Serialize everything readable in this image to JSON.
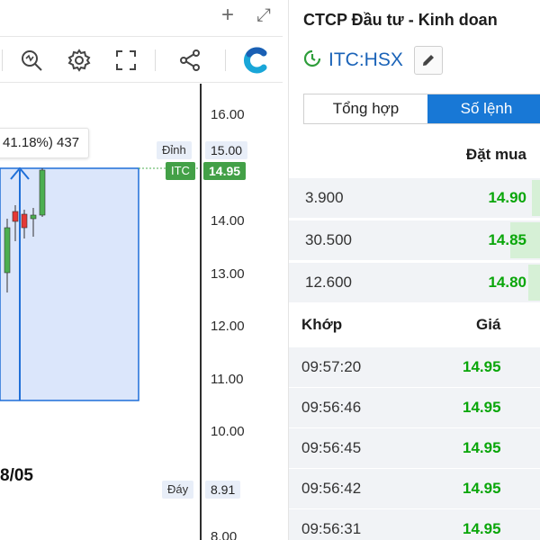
{
  "window_controls": {
    "add_symbol": "+",
    "expand_symbol": "⤢"
  },
  "chart": {
    "tooltip_text": "41.18%) 437",
    "date_label": "8/05",
    "price_ticks": [
      "16.00",
      "14.00",
      "13.00",
      "12.00",
      "11.00",
      "10.00",
      "8.00"
    ],
    "high_label": "Đỉnh",
    "high_value": "15.00",
    "current_label": "ITC",
    "current_value": "14.95",
    "low_label": "Đáy",
    "low_value": "8.91",
    "colors": {
      "up": "#4caf50",
      "down": "#e53935",
      "band": "#dbe6fb",
      "accent": "#1f6fd8",
      "badge_green": "#43a047"
    }
  },
  "side": {
    "company_name": "CTCP Đầu tư - Kinh doan",
    "ticker": "ITC:HSX",
    "tabs": {
      "summary": "Tổng hợp",
      "orders": "Số lệnh"
    },
    "bid_header": "Đặt mua",
    "bids": [
      {
        "qty": "3.900",
        "price": "14.90"
      },
      {
        "qty": "30.500",
        "price": "14.85"
      },
      {
        "qty": "12.600",
        "price": "14.80"
      }
    ],
    "match_header": {
      "col1": "Khớp",
      "col2": "Giá"
    },
    "matches": [
      {
        "time": "09:57:20",
        "price": "14.95"
      },
      {
        "time": "09:56:46",
        "price": "14.95"
      },
      {
        "time": "09:56:45",
        "price": "14.95"
      },
      {
        "time": "09:56:42",
        "price": "14.95"
      },
      {
        "time": "09:56:31",
        "price": "14.95"
      }
    ]
  }
}
